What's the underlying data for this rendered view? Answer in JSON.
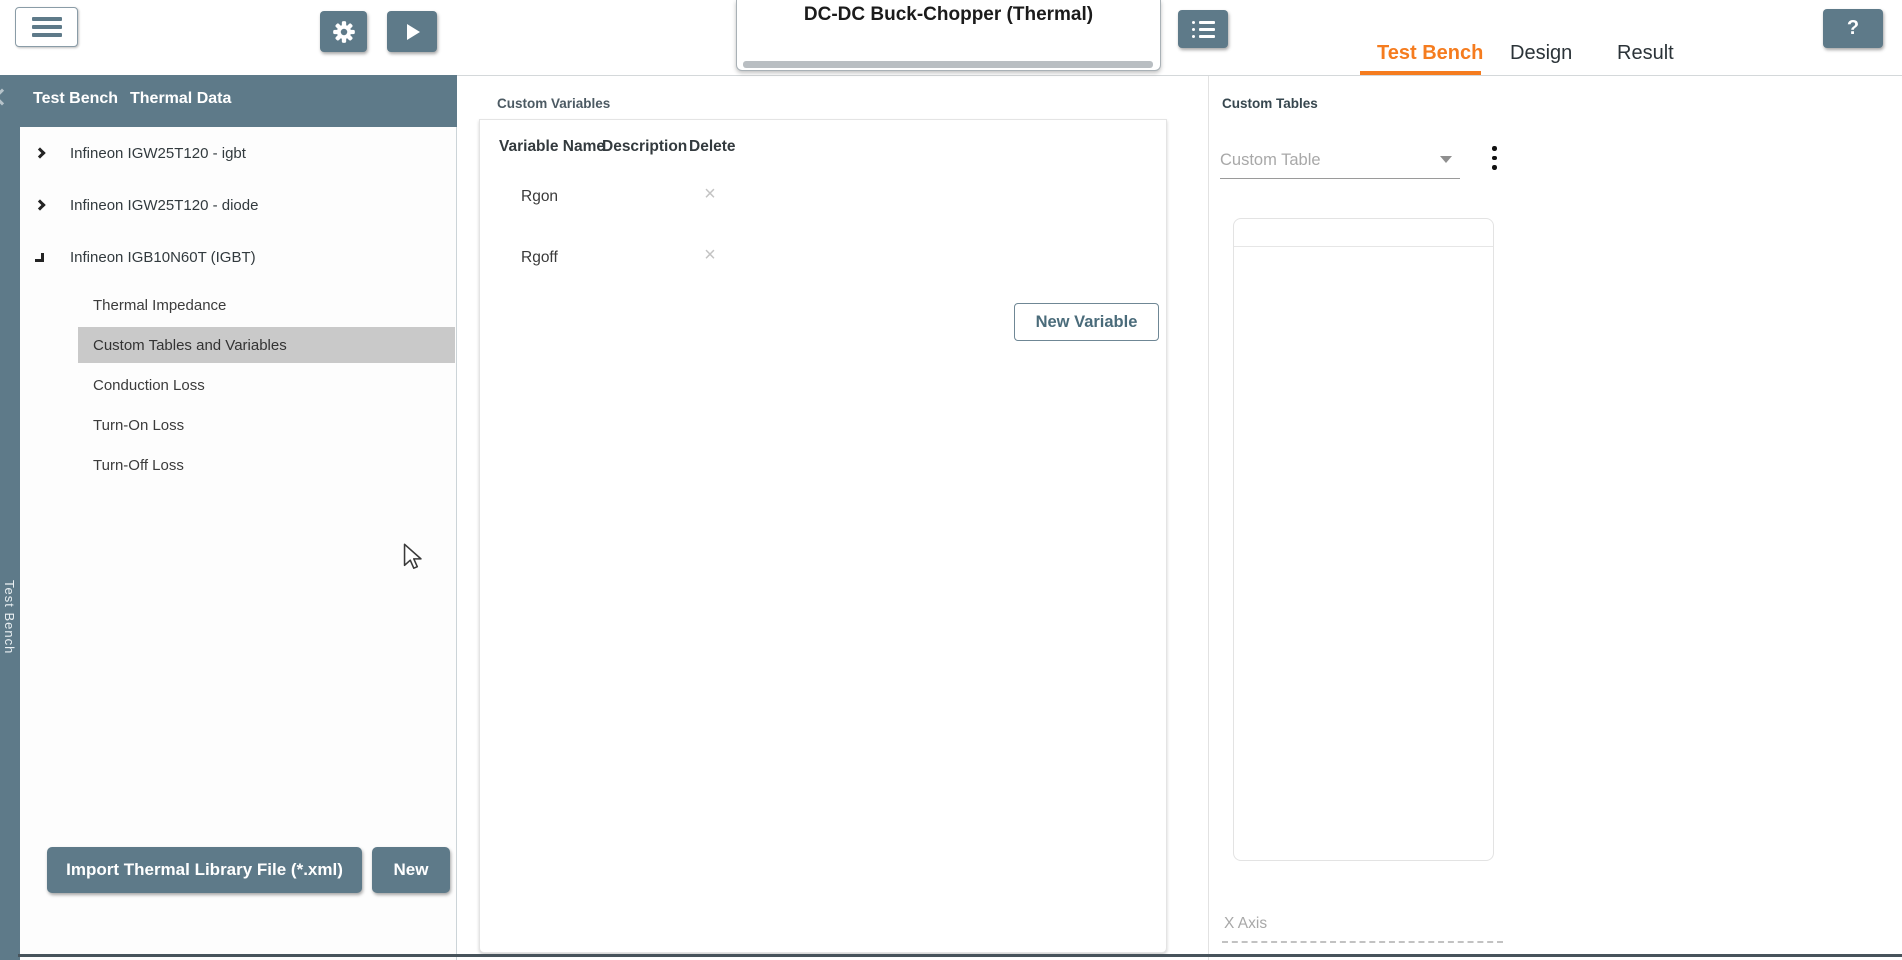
{
  "topbar": {
    "title": "DC-DC Buck-Chopper (Thermal)",
    "tabs": [
      {
        "label": "Test Bench",
        "active": true
      },
      {
        "label": "Design",
        "active": false
      },
      {
        "label": "Result",
        "active": false
      }
    ],
    "help_label": "?"
  },
  "sidebar": {
    "header_tabs": [
      "Test Bench",
      "Thermal Data"
    ],
    "vertical_label": "Test Bench",
    "tree": [
      {
        "label": "Infineon IGW25T120 - igbt",
        "state": "collapsed"
      },
      {
        "label": "Infineon IGW25T120 - diode",
        "state": "collapsed"
      },
      {
        "label": "Infineon IGB10N60T (IGBT)",
        "state": "expanded",
        "children": [
          "Thermal Impedance",
          "Custom Tables and Variables",
          "Conduction Loss",
          "Turn-On Loss",
          "Turn-Off Loss"
        ],
        "selected_child": "Custom Tables and Variables"
      }
    ],
    "import_button": "Import Thermal Library File (*.xml)",
    "new_button": "New"
  },
  "variables_panel": {
    "title": "Custom Variables",
    "columns": [
      "Variable Name",
      "Description",
      "Delete"
    ],
    "rows": [
      {
        "name": "Rgon",
        "description": ""
      },
      {
        "name": "Rgoff",
        "description": ""
      }
    ],
    "delete_glyph": "×",
    "new_variable_button": "New Variable"
  },
  "tables_panel": {
    "title": "Custom Tables",
    "table_select_placeholder": "Custom Table",
    "x_axis_placeholder": "X Axis"
  },
  "colors": {
    "accent_orange": "#f57c1f",
    "slate": "#5e7a89",
    "selected_row": "#c9c9c9"
  }
}
